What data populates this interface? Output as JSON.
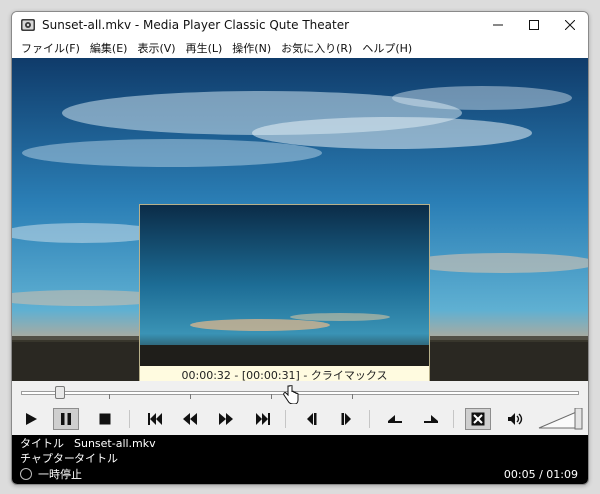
{
  "window": {
    "title": "Sunset-all.mkv - Media Player Classic Qute Theater"
  },
  "menu": [
    "ファイル(F)",
    "編集(E)",
    "表示(V)",
    "再生(L)",
    "操作(N)",
    "お気に入り(R)",
    "ヘルプ(H)"
  ],
  "preview": {
    "caption": "00:00:32 - [00:00:31] - クライマックス"
  },
  "seek": {
    "position_fraction": 0.07
  },
  "controls": {
    "buttons": [
      "play",
      "pause",
      "stop",
      "prev-chapter",
      "rewind",
      "fast-forward",
      "next-chapter",
      "frame-back",
      "frame-forward",
      "slow-down",
      "speed-up",
      "subtitle-toggle",
      "volume"
    ],
    "volume_fraction": 1.0
  },
  "status": {
    "title_label": "タイトル",
    "title_value": "Sunset-all.mkv",
    "chapter_label": "チャプター",
    "chapter_value": "タイトル",
    "state": "一時停止",
    "time": "00:05 / 01:09"
  },
  "colors": {
    "sky": "#2a6fa5",
    "preview_bg": "#fffbe0",
    "status_bg": "#000000"
  }
}
